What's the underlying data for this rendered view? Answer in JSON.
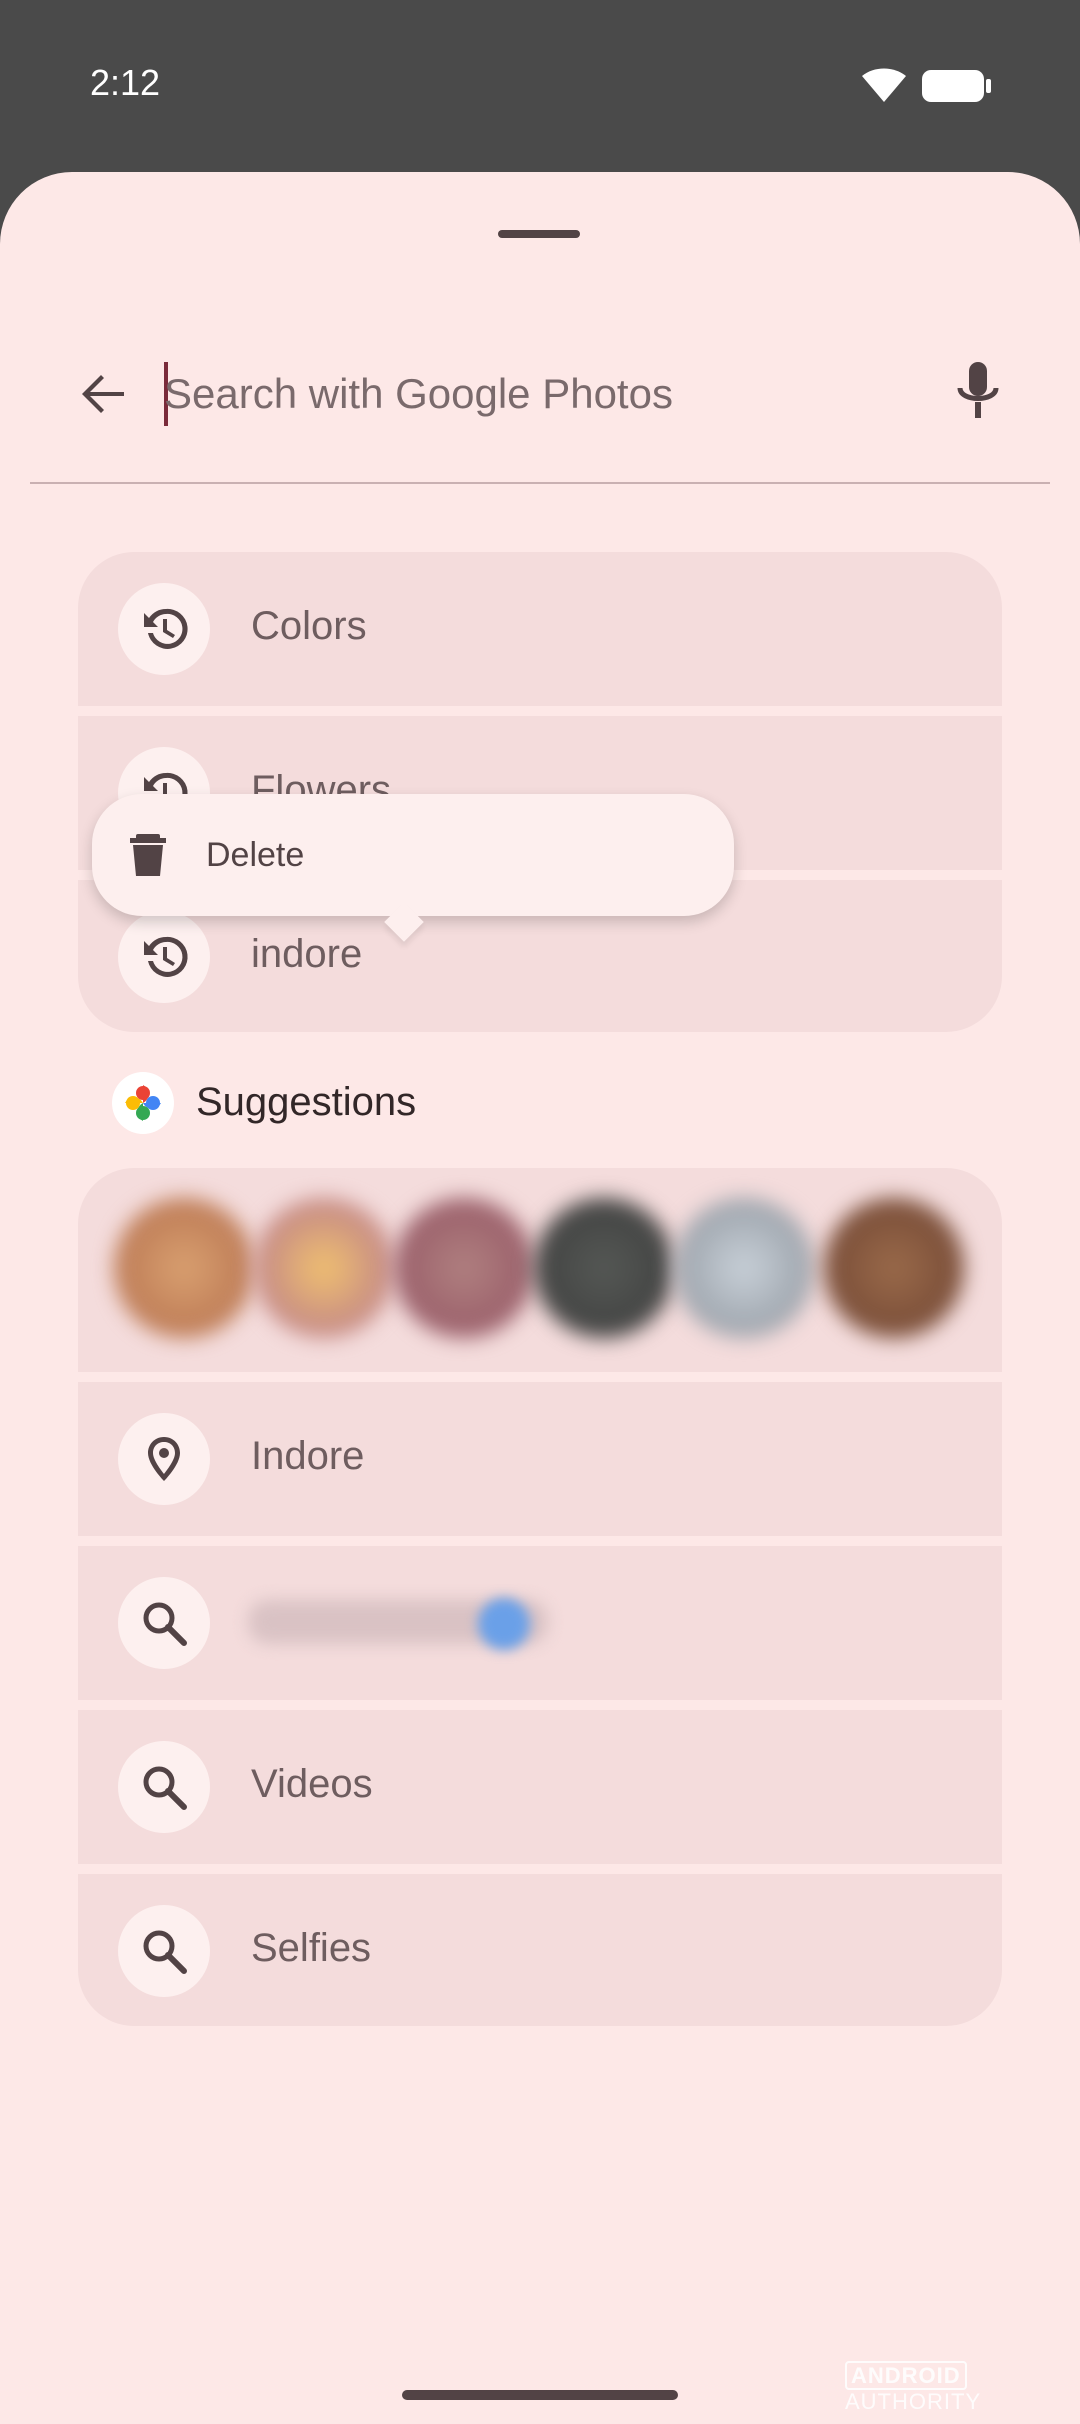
{
  "status_bar": {
    "time": "2:12"
  },
  "search": {
    "placeholder": "Search with Google Photos"
  },
  "history": [
    {
      "label": "Colors"
    },
    {
      "label": "Flowers"
    },
    {
      "label": "indore"
    }
  ],
  "context_menu": {
    "delete_label": "Delete"
  },
  "suggestions": {
    "title": "Suggestions",
    "items": [
      {
        "label": "Indore",
        "icon": "location-pin-icon"
      },
      {
        "label": "",
        "icon": "search-icon"
      },
      {
        "label": "Videos",
        "icon": "search-icon"
      },
      {
        "label": "Selfies",
        "icon": "search-icon"
      }
    ]
  },
  "watermark": {
    "brand": "ANDROID",
    "brand2": "AUTHORITY"
  },
  "colors": {
    "background": "#fde8e7",
    "row": "#f4dcdc",
    "text": "#6e5d5f"
  }
}
